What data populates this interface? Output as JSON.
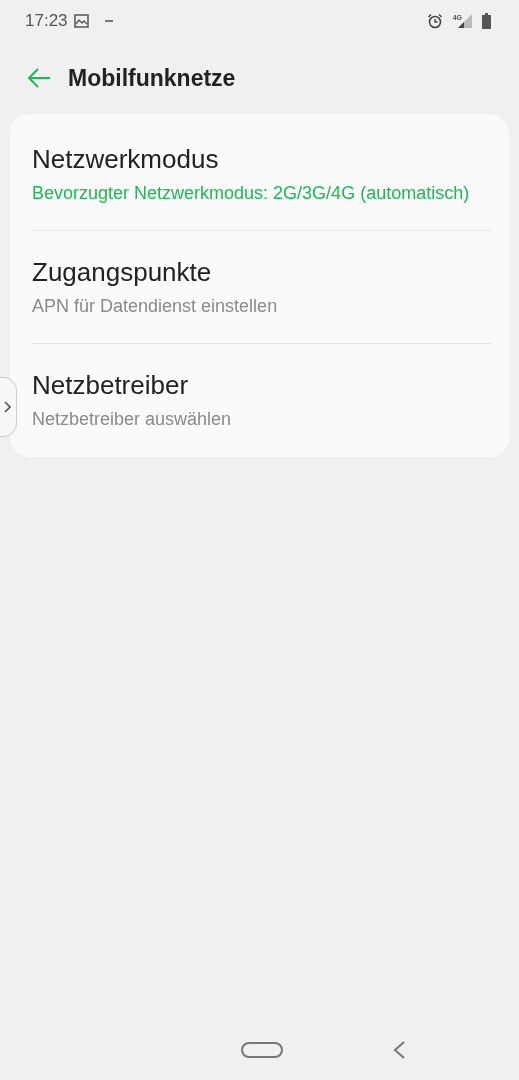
{
  "status_bar": {
    "time": "17:23",
    "network": "4G"
  },
  "header": {
    "title": "Mobilfunknetze"
  },
  "items": [
    {
      "title": "Netzwerkmodus",
      "summary": "Bevorzugter Netzwerkmodus: 2G/3G/4G (automatisch)",
      "kind": "value"
    },
    {
      "title": "Zugangspunkte",
      "summary": "APN für Datendienst einstellen",
      "kind": "hint"
    },
    {
      "title": "Netzbetreiber",
      "summary": "Netzbetreiber auswählen",
      "kind": "hint"
    }
  ]
}
